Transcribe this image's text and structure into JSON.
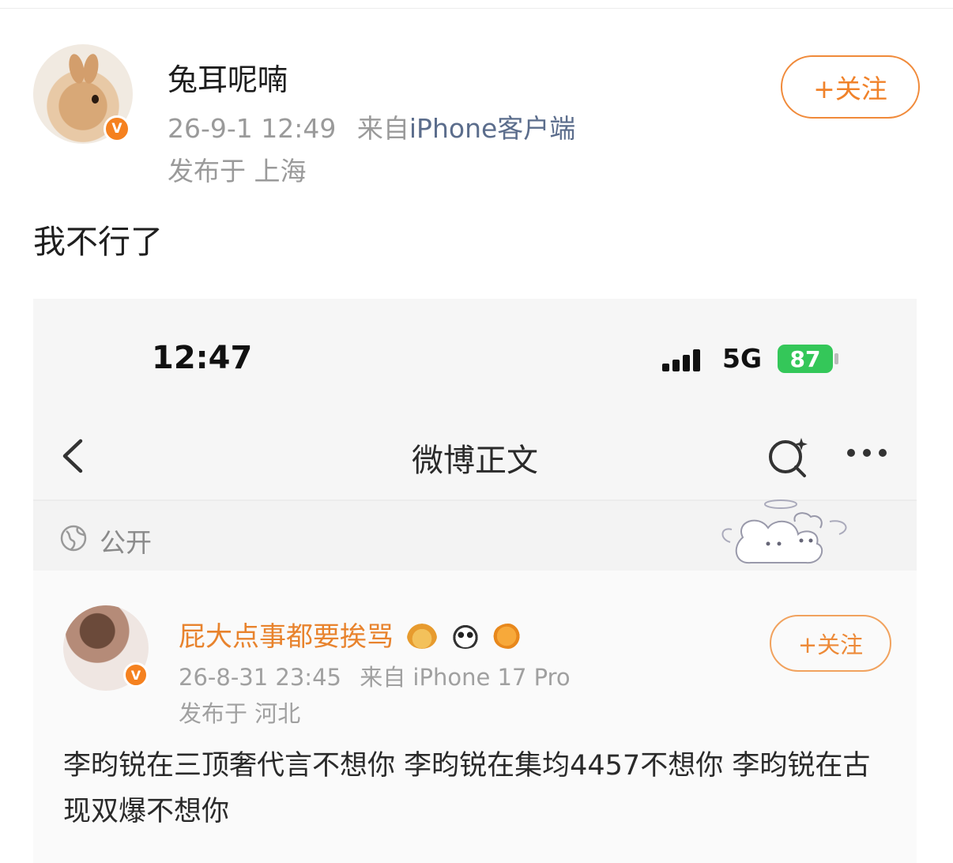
{
  "post": {
    "username": "兔耳呢喃",
    "timestamp": "26-9-1 12:49",
    "source_prefix": "来自",
    "source": "iPhone客户端",
    "location": "发布于 上海",
    "follow_label": "+关注",
    "badge": "V",
    "text": "我不行了"
  },
  "screenshot": {
    "status_bar": {
      "time": "12:47",
      "network": "5G",
      "battery": "87"
    },
    "nav": {
      "title": "微博正文"
    },
    "visibility": {
      "label": "公开"
    },
    "inner_post": {
      "username": "屁大点事都要挨骂",
      "timestamp": "26-8-31 23:45",
      "source": "来自 iPhone 17 Pro",
      "location": "发布于 河北",
      "follow_label": "+关注",
      "badge": "V",
      "text": "李昀锐在三顶奢代言不想你 李昀锐在集均4457不想你 李昀锐在古现双爆不想你"
    }
  },
  "colors": {
    "accent": "#f0822a",
    "link": "#5b6d8c",
    "battery": "#34c759"
  },
  "icons": [
    "back-icon",
    "search-icon",
    "more-icon",
    "globe-icon",
    "verified-icon",
    "crown-emoji",
    "panda-emoji",
    "fish-emoji"
  ]
}
